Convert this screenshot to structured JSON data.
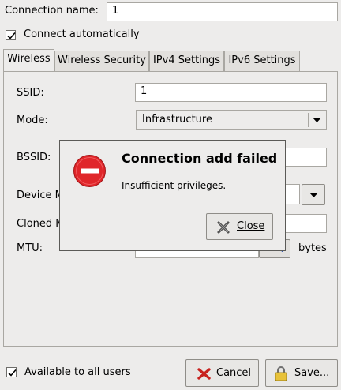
{
  "connection_name": {
    "label": "Connection name:",
    "value": "1"
  },
  "connect_automatically": {
    "label": "Connect automatically",
    "checked": true
  },
  "tabs": [
    {
      "label": "Wireless",
      "active": true
    },
    {
      "label": "Wireless Security",
      "active": false
    },
    {
      "label": "IPv4 Settings",
      "active": false
    },
    {
      "label": "IPv6 Settings",
      "active": false
    }
  ],
  "wireless": {
    "ssid_label": "SSID:",
    "ssid_value": "1",
    "mode_label": "Mode:",
    "mode_value": "Infrastructure",
    "bssid_label": "BSSID:",
    "device_mac_label": "Device M",
    "cloned_mac_label": "Cloned M",
    "mtu_label": "MTU:",
    "mtu_unit": "bytes"
  },
  "footer": {
    "available_label": "Available to all users",
    "available_checked": true,
    "cancel_label": "Cancel",
    "save_label": "Save..."
  },
  "error_dialog": {
    "title": "Connection add failed",
    "message": "Insufficient privileges.",
    "close_label": "Close"
  },
  "colors": {
    "error_icon": "#e0262a",
    "window_bg": "#edeceb"
  }
}
